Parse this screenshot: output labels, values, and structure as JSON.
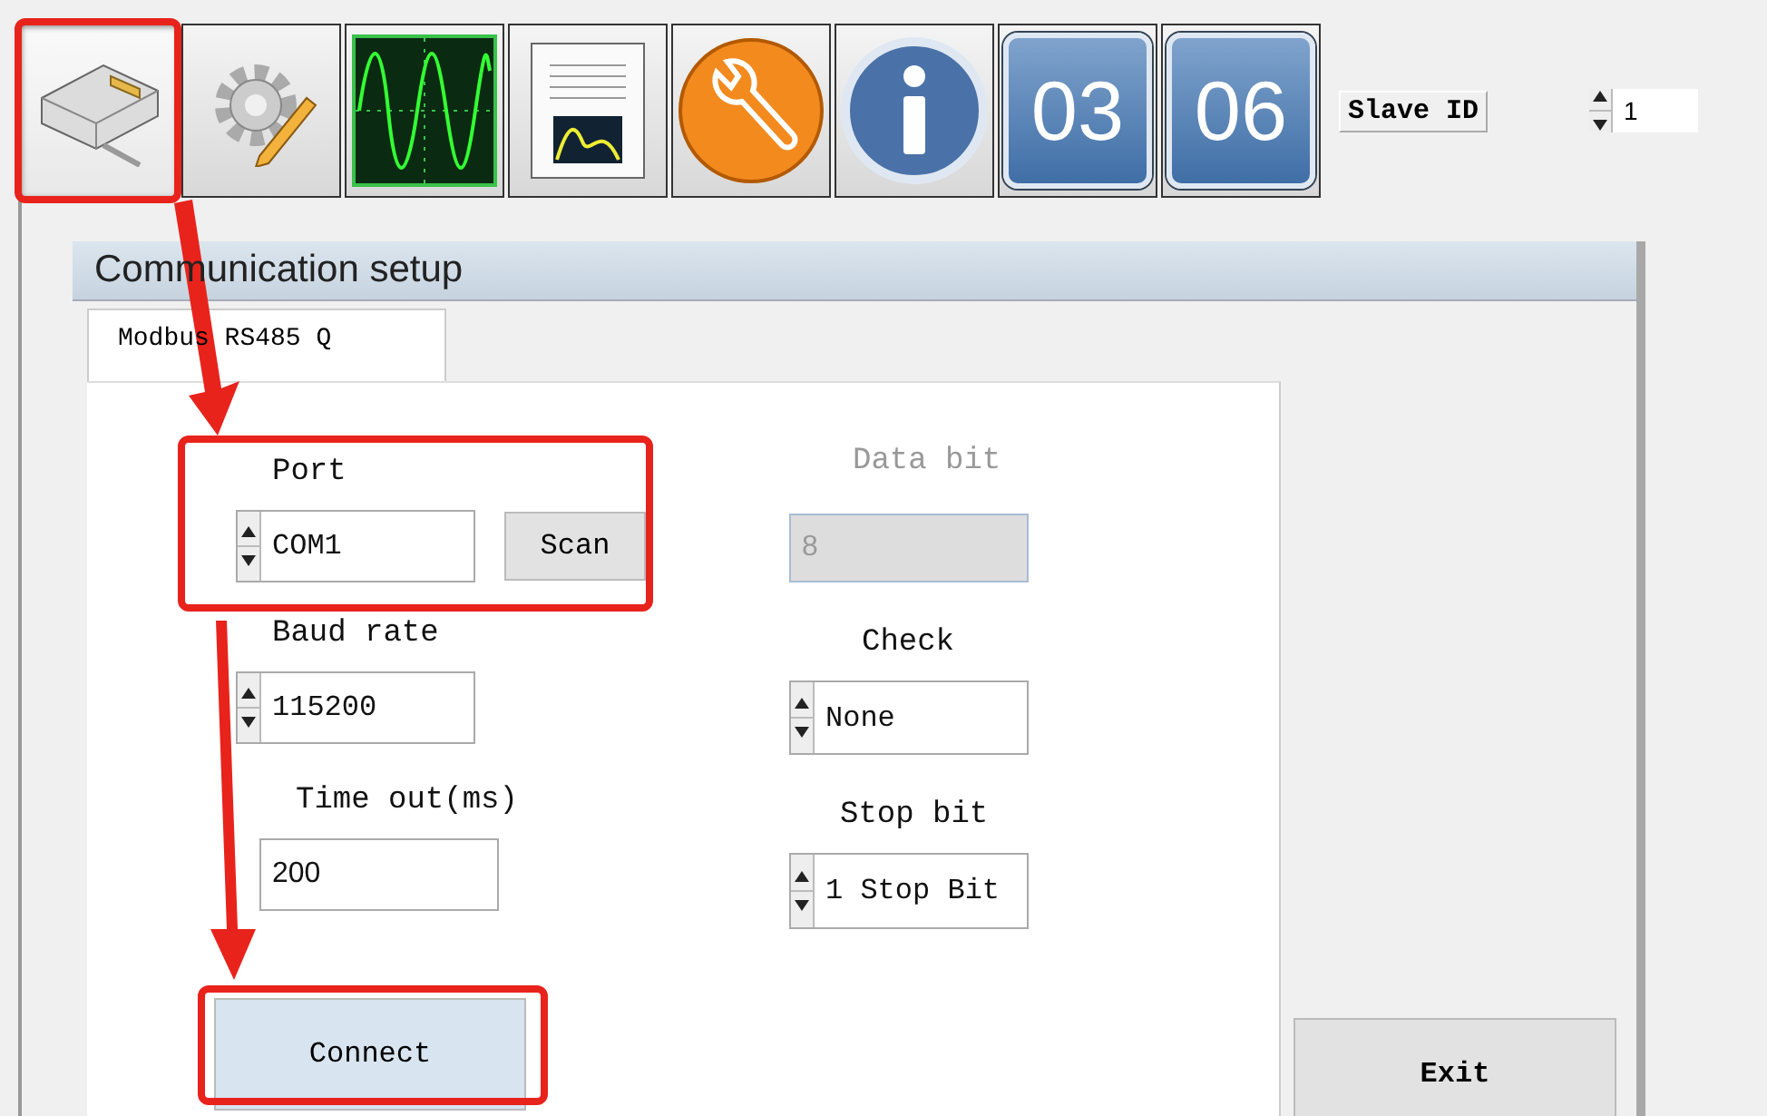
{
  "toolbar": {
    "buttons": [
      {
        "kind": "connector",
        "selected": true
      },
      {
        "kind": "gear-pencil",
        "selected": false
      },
      {
        "kind": "oscilloscope",
        "selected": false
      },
      {
        "kind": "chart-document",
        "selected": false
      },
      {
        "kind": "wrench",
        "selected": false
      },
      {
        "kind": "info",
        "selected": false
      },
      {
        "kind": "number",
        "label": "03",
        "selected": false
      },
      {
        "kind": "number",
        "label": "06",
        "selected": false
      }
    ],
    "slave_id": {
      "label": "Slave ID",
      "value": "1"
    }
  },
  "dialog": {
    "title": "Communication setup",
    "tabs": [
      {
        "label": "Modbus RS485 Q",
        "selected": true
      }
    ],
    "left_fields": [
      {
        "kind": "spinner",
        "label": "Port",
        "value": "COM1",
        "disabled": false,
        "button": "Scan"
      },
      {
        "kind": "spinner",
        "label": "Baud rate",
        "value": "115200",
        "disabled": false
      },
      {
        "kind": "text",
        "label": "Time out(ms)",
        "value": "200",
        "disabled": false
      }
    ],
    "right_fields": [
      {
        "kind": "text",
        "label": "Data bit",
        "value": "8",
        "disabled": true
      },
      {
        "kind": "spinner",
        "label": "Check",
        "value": "None",
        "disabled": false
      },
      {
        "kind": "spinner",
        "label": "Stop bit",
        "value": "1 Stop Bit",
        "disabled": false
      }
    ],
    "connect_button": "Connect",
    "exit_button": "Exit"
  },
  "annotations": [
    {
      "kind": "box"
    },
    {
      "kind": "box"
    },
    {
      "kind": "box"
    },
    {
      "kind": "arrow"
    },
    {
      "kind": "arrow"
    }
  ]
}
